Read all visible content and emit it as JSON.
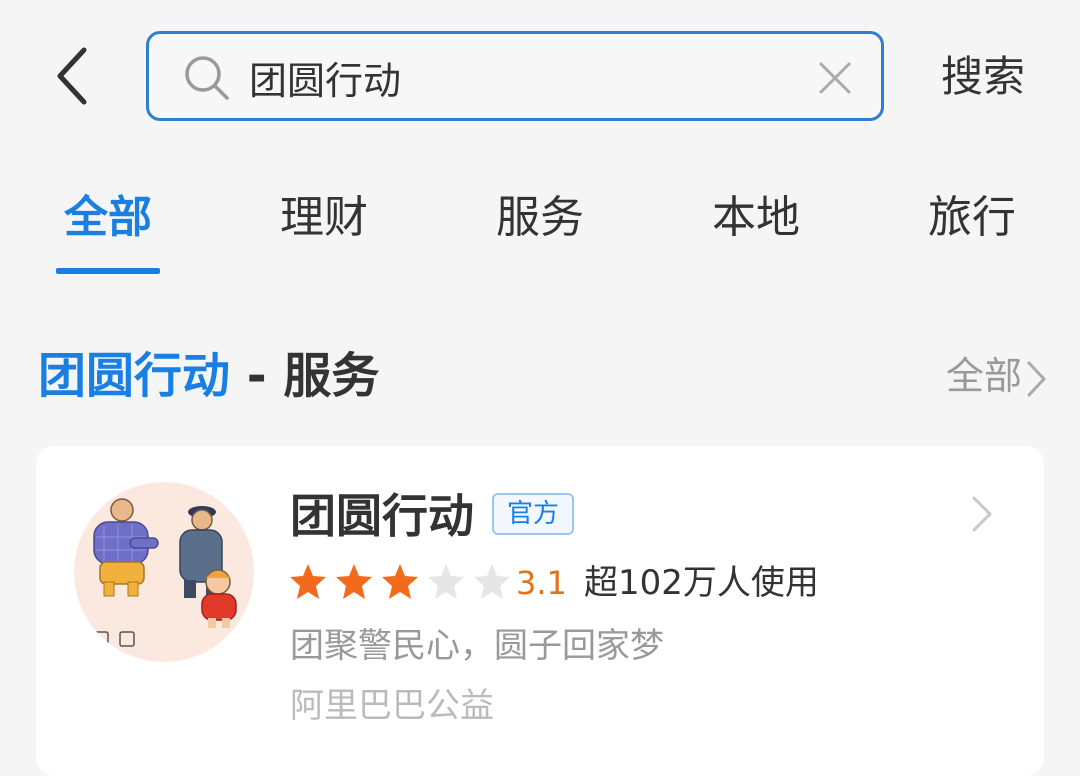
{
  "search": {
    "query": "团圆行动",
    "button_label": "搜索"
  },
  "tabs": [
    {
      "label": "全部",
      "active": true
    },
    {
      "label": "理财",
      "active": false
    },
    {
      "label": "服务",
      "active": false
    },
    {
      "label": "本地",
      "active": false
    },
    {
      "label": "旅行",
      "active": false
    }
  ],
  "section": {
    "keyword": "团圆行动",
    "suffix": " - 服务",
    "see_all_label": "全部"
  },
  "result": {
    "name": "团圆行动",
    "badge": "官方",
    "rating": 3.1,
    "rating_text": "3.1",
    "stars_filled": 3,
    "stars_total": 5,
    "usage": "超102万人使用",
    "description": "团聚警民心，圆子回家梦",
    "provider": "阿里巴巴公益"
  },
  "icons": {
    "back": "chevron-left-icon",
    "search": "search-icon",
    "clear": "close-icon",
    "more": "chevron-right-icon",
    "star": "star-icon"
  },
  "colors": {
    "accent": "#1a7fe3",
    "star_filled": "#f26b1d",
    "star_empty": "#e6e6e6",
    "rating_text": "#e2731a"
  }
}
